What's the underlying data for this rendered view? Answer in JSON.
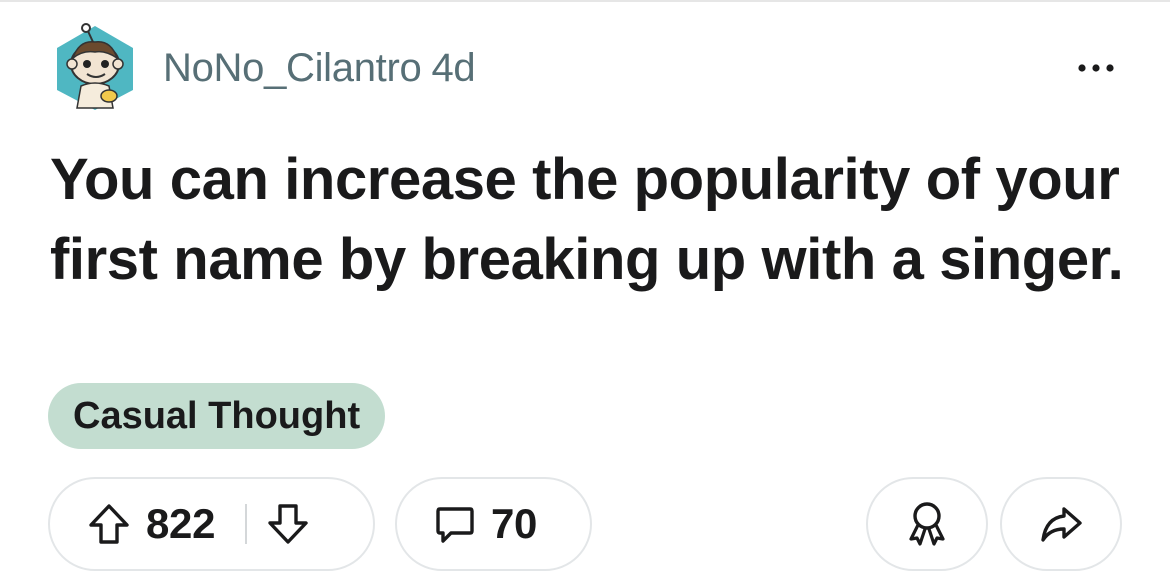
{
  "post": {
    "author": "NoNo_Cilantro",
    "age": "4d",
    "title": "You can increase the popularity of your first name by breaking up with a singer.",
    "flair": "Casual Thought"
  },
  "actions": {
    "upvotes": "822",
    "comments": "70"
  },
  "colors": {
    "flair_bg": "#c3ddd0",
    "avatar_bg": "#4fb7c2",
    "meta_text": "#576f76"
  },
  "icons": {
    "avatar": "snoo-avatar-icon",
    "more": "more-options-icon",
    "upvote": "upvote-arrow-icon",
    "downvote": "downvote-arrow-icon",
    "comment": "comment-bubble-icon",
    "award": "award-icon",
    "share": "share-arrow-icon"
  }
}
